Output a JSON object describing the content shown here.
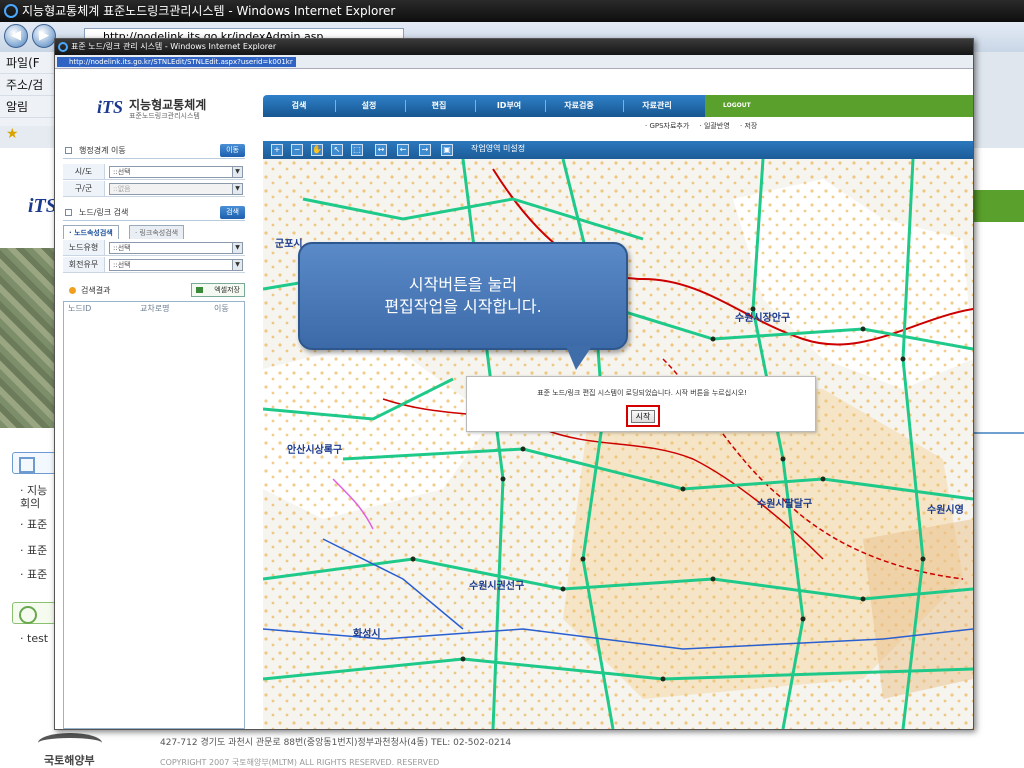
{
  "outer": {
    "title": "지능형교통체계 표준노드링크관리시스템 - Windows Internet Explorer",
    "address": "http://nodelink.its.go.kr/indexAdmin.asp",
    "menu": [
      "파일(F",
      "주소/검",
      "알림"
    ],
    "logo": "iTS",
    "notices": [
      "지능",
      "회의",
      "표준",
      "표준",
      "표준"
    ],
    "recent": "test",
    "footer": {
      "logo_text": "국토해양부",
      "address": "427-712 경기도 과천시 관문로 88번(중앙동1번지)정부과천청사(4동)  TEL: 02-502-0214",
      "copyright": "COPYRIGHT 2007 국토해양부(MLTM) ALL RIGHTS RESERVED. RESERVED"
    }
  },
  "popup": {
    "title": "표준 노드/링크 관리 시스템 - Windows Internet Explorer",
    "address": "http://nodelink.its.go.kr/STNLEdit/STNLEdit.aspx?userid=k001kr",
    "brand": {
      "logo": "iTS",
      "name": "지능형교통체계",
      "sub": "표준노드링크관리시스템"
    },
    "admin_move": {
      "label": "행정경계 이동",
      "button": "이동",
      "rows": [
        {
          "key": "시/도",
          "value": "::선택",
          "disabled": false
        },
        {
          "key": "구/군",
          "value": "::없음",
          "disabled": true
        }
      ]
    },
    "node_search": {
      "label": "노드/링크 검색",
      "button": "검색",
      "tabs": [
        "노드속성검색",
        "링크속성검색"
      ],
      "rows": [
        {
          "key": "노드유형",
          "value": "::선택"
        },
        {
          "key": "회전유무",
          "value": "::선택"
        }
      ]
    },
    "results": {
      "label": "검색결과",
      "excel_button": "엑셀저장",
      "columns": [
        "노드ID",
        "교차로명",
        "이동"
      ]
    },
    "top_menu": [
      "검색",
      "설정",
      "편집",
      "ID부여",
      "자료검증",
      "자료관리"
    ],
    "logout": "LOGOUT",
    "sub_menu": [
      "· GPS자료추가",
      "· 일괄반영",
      "· 저장"
    ],
    "map_status": "작업영역 미설정",
    "map_labels": [
      "군포시",
      "안산시상록구",
      "수원시장안구",
      "수원시팔달구",
      "수원시영",
      "수원시권선구",
      "화성시"
    ],
    "callout": {
      "line1": "시작버튼을 눌러",
      "line2": "편집작업을 시작합니다."
    },
    "dialog": {
      "message": "표준 노드/링크 편집 시스템이 로딩되었습니다. 시작 버튼을 누르십시오!",
      "start_button": "시작"
    }
  },
  "colors": {
    "menu_blue": "#1f64a8",
    "logout_green": "#5aa02c",
    "callout_blue": "#4a78b6",
    "highlight_red": "#d40000",
    "road_green": "#1ec98a",
    "road_orange": "#f0a020",
    "boundary_red": "#cc0000"
  }
}
